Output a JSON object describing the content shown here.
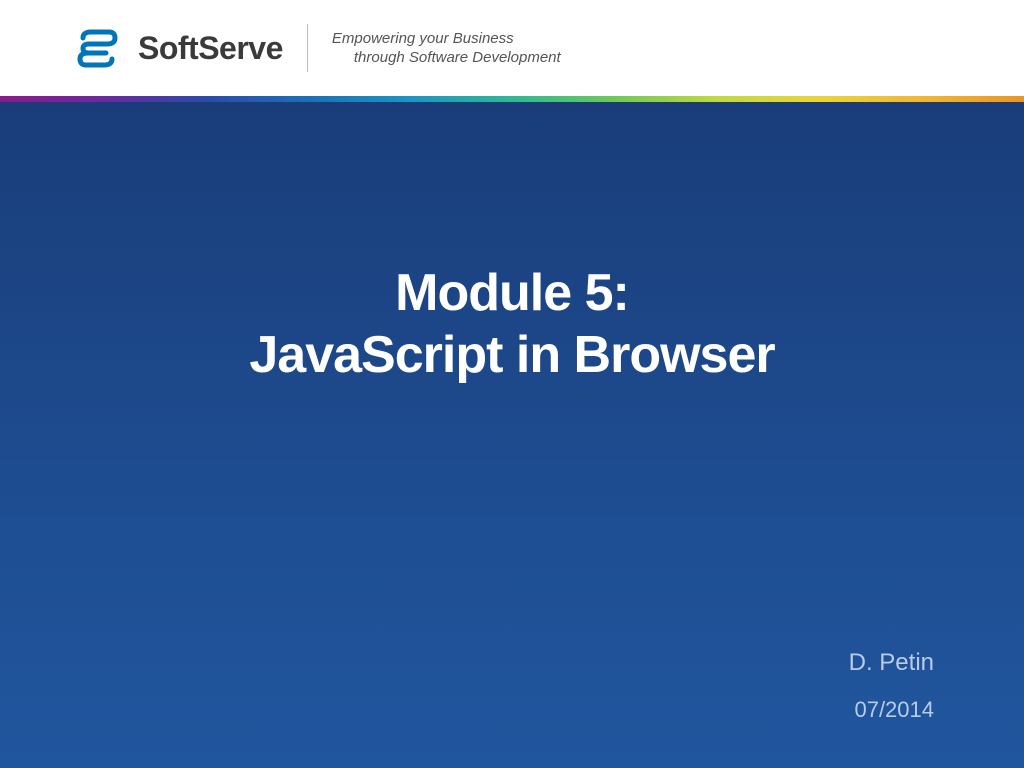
{
  "header": {
    "company_name": "SoftServe",
    "tagline_line1": "Empowering your Business",
    "tagline_line2": "through Software Development"
  },
  "main": {
    "title_line1": "Module 5:",
    "title_line2": "JavaScript in Browser",
    "author": "D. Petin",
    "date": "07/2014"
  }
}
